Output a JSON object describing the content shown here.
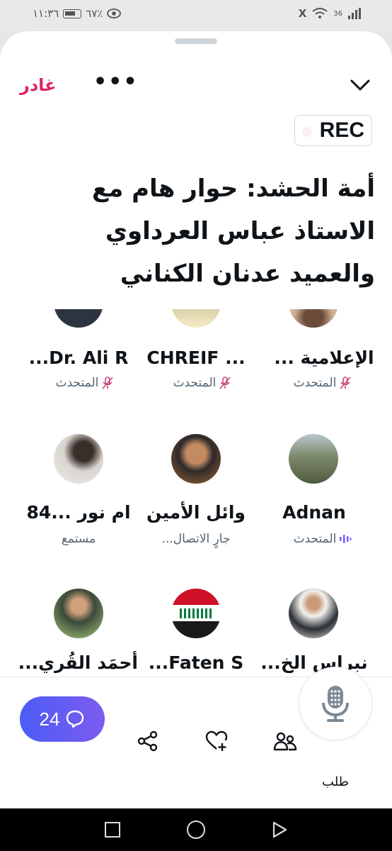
{
  "status": {
    "time": "١١:٣٦",
    "battery": "٦٧٪",
    "network": "36",
    "x_label": "X"
  },
  "header": {
    "leave_label": "غادر",
    "more_label": "•••",
    "rec_label": "REC"
  },
  "space": {
    "title": "أمة الحشد: حوار هام مع الاستاذ عباس العرداوي والعميد عدنان الكناني"
  },
  "participants": [
    {
      "name": "الإعلامية ...",
      "role": "المتحدث",
      "mic": "muted"
    },
    {
      "name": "... CHREIF",
      "role": "المتحدث",
      "mic": "muted"
    },
    {
      "name": "Dr. Ali R...",
      "role": "المتحدث",
      "mic": "muted"
    },
    {
      "name": "Adnan",
      "role": "المتحدث",
      "mic": "speaking"
    },
    {
      "name": "وائل الأمين",
      "role": "جارٍ الاتصال...",
      "mic": "none"
    },
    {
      "name": "ام نور ...84",
      "role": "مستمع",
      "mic": "none"
    },
    {
      "name": "نبراس الخ...",
      "role": "",
      "mic": "none"
    },
    {
      "name": "Faten S...",
      "role": "",
      "mic": "none"
    },
    {
      "name": "أحمَد القُري...",
      "role": "",
      "mic": "none"
    }
  ],
  "footer": {
    "comments_count": "24",
    "request_label": "طلب"
  },
  "colors": {
    "leave": "#e0245e",
    "accent_gradient_start": "#4b5cf6",
    "accent_gradient_end": "#7d5cf0",
    "muted_mic": "#c9437a",
    "speaking": "#7856ff"
  }
}
